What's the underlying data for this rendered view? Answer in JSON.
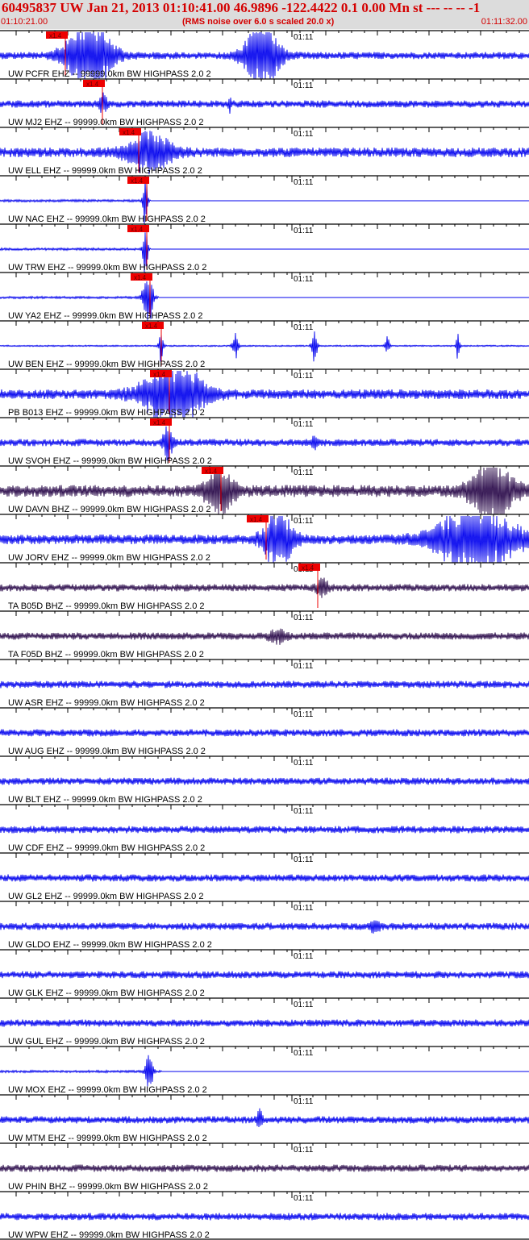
{
  "header": {
    "title": "60495837 UW Jan 21, 2013 01:10:41.00   46.9896 -122.4422  0.1 0.00 Mn st --- -- --  -1",
    "start_time": "01:10:21.00",
    "noise_note": "(RMS noise over 6.0 s scaled 20.0 x)",
    "end_time": "01:11:32.00"
  },
  "minute_label": "01:11",
  "colors": {
    "trace": "#0000ee",
    "trace_dark": "#2a0a4a",
    "pick": "#ee0000",
    "title": "#d40000",
    "header_bg": "#dcdcdc"
  },
  "traces": [
    {
      "label": "UW PCFR EHZ -- 99999.0km BW  HIGHPASS  2.0  2",
      "pick": "x1.4"
    },
    {
      "label": "UW MJ2 EHZ -- 99999.0km BW  HIGHPASS  2.0  2",
      "pick": "x1.4"
    },
    {
      "label": "UW ELL EHZ -- 99999.0km BW  HIGHPASS  2.0  2",
      "pick": "x1.4"
    },
    {
      "label": "UW NAC EHZ -- 99999.0km BW  HIGHPASS  2.0  2",
      "pick": "x1.4"
    },
    {
      "label": "UW TRW EHZ -- 99999.0km BW  HIGHPASS  2.0  2",
      "pick": "x1.4"
    },
    {
      "label": "UW YA2 EHZ -- 99999.0km BW  HIGHPASS  2.0  2",
      "pick": "x1.4"
    },
    {
      "label": "UW BEN EHZ -- 99999.0km BW  HIGHPASS  2.0  2",
      "pick": "x1.4"
    },
    {
      "label": "PB B013 EHZ -- 99999.0km BW  HIGHPASS  2.0  2",
      "pick": "x1.4"
    },
    {
      "label": "UW SVOH EHZ -- 99999.0km BW  HIGHPASS  2.0  2",
      "pick": "x1.4"
    },
    {
      "label": "UW DAVN BHZ -- 99999.0km BW  HIGHPASS  2.0  2",
      "pick": "x1.4"
    },
    {
      "label": "UW JORV EHZ -- 99999.0km BW  HIGHPASS  2.0  2",
      "pick": "x1.4"
    },
    {
      "label": "TA B05D BHZ -- 99999.0km BW  HIGHPASS  2.0  2",
      "pick": "x1.4"
    },
    {
      "label": "TA F05D BHZ -- 99999.0km BW  HIGHPASS  2.0  2",
      "pick": ""
    },
    {
      "label": "UW ASR EHZ -- 99999.0km BW  HIGHPASS  2.0  2",
      "pick": ""
    },
    {
      "label": "UW AUG EHZ -- 99999.0km BW  HIGHPASS  2.0  2",
      "pick": ""
    },
    {
      "label": "UW BLT EHZ -- 99999.0km BW  HIGHPASS  2.0  2",
      "pick": ""
    },
    {
      "label": "UW CDF EHZ -- 99999.0km BW  HIGHPASS  2.0  2",
      "pick": ""
    },
    {
      "label": "UW GL2 EHZ -- 99999.0km BW  HIGHPASS  2.0  2",
      "pick": ""
    },
    {
      "label": "UW GLDO EHZ -- 99999.0km BW  HIGHPASS  2.0  2",
      "pick": ""
    },
    {
      "label": "UW GLK EHZ -- 99999.0km BW  HIGHPASS  2.0  2",
      "pick": ""
    },
    {
      "label": "UW GUL EHZ -- 99999.0km BW  HIGHPASS  2.0  2",
      "pick": ""
    },
    {
      "label": "UW MOX EHZ -- 99999.0km BW  HIGHPASS  2.0  2",
      "pick": ""
    },
    {
      "label": "UW MTM EHZ -- 99999.0km BW  HIGHPASS  2.0  2",
      "pick": ""
    },
    {
      "label": "UW PHIN BHZ -- 99999.0km BW  HIGHPASS  2.0  2",
      "pick": ""
    },
    {
      "label": "UW WPW EHZ -- 99999.0km BW  HIGHPASS  2.0  2",
      "pick": ""
    }
  ]
}
